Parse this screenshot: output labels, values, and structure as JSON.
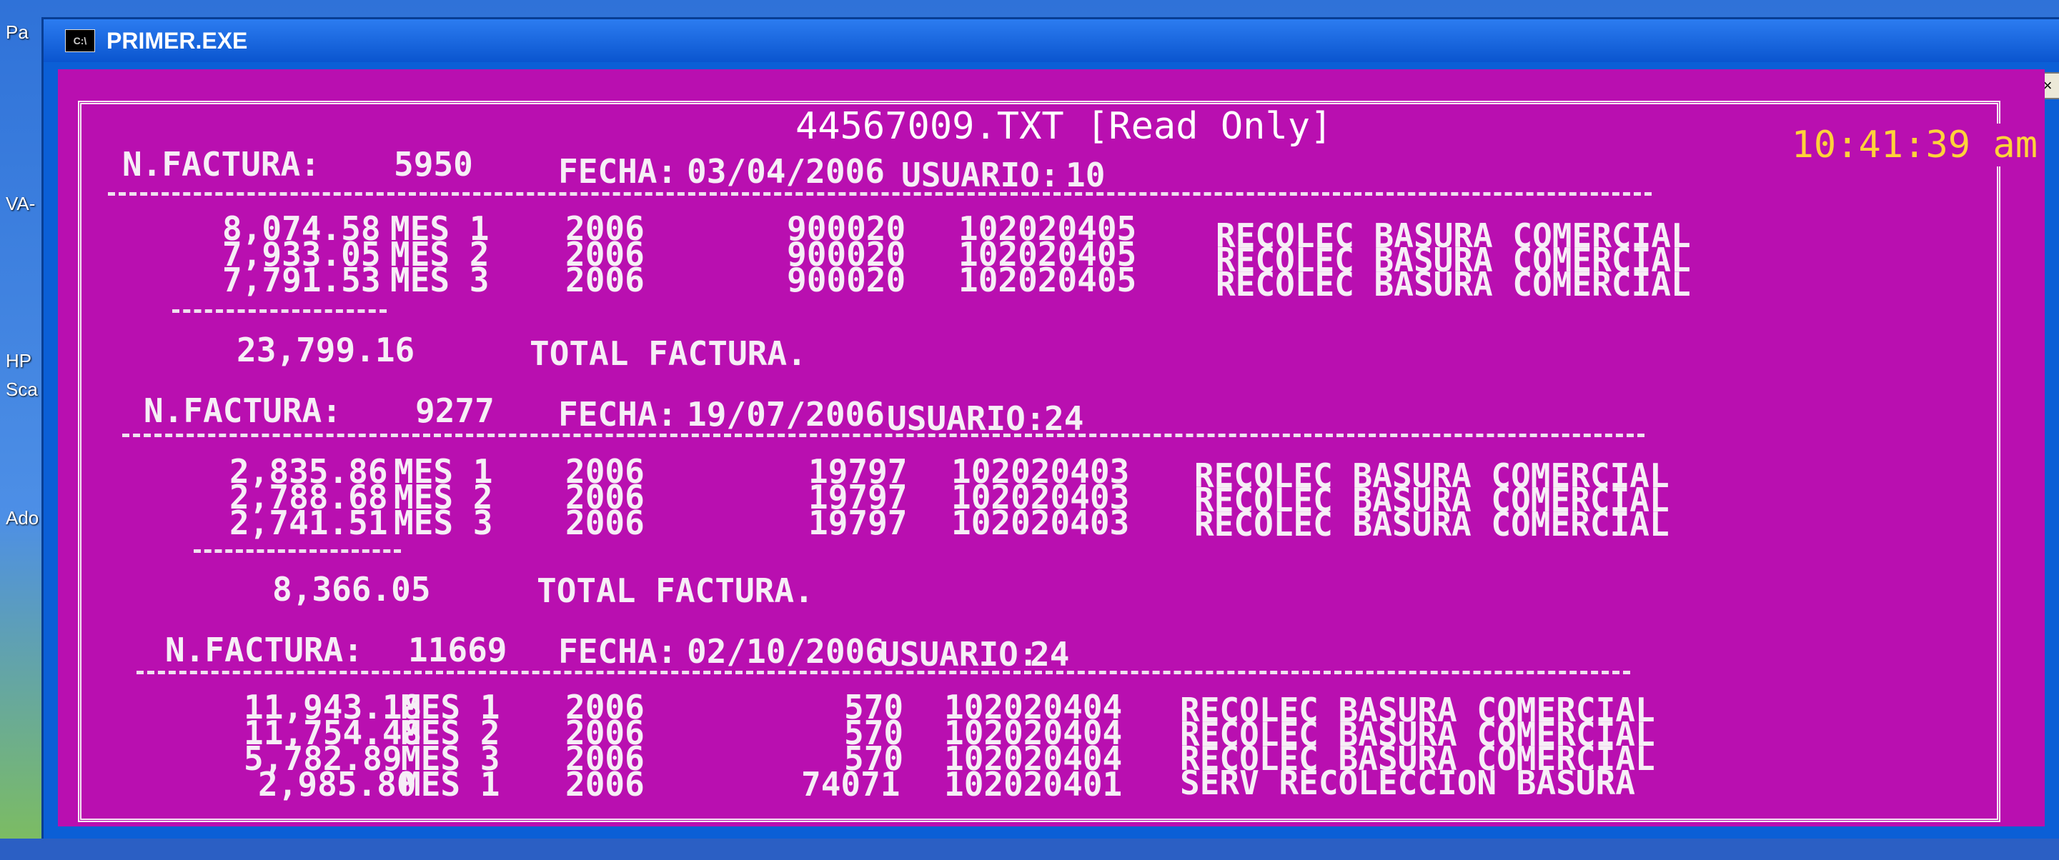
{
  "desktop": {
    "icon_labels": [
      "Pa",
      "VA-",
      "HP",
      "Sca",
      "Ado"
    ]
  },
  "window": {
    "title": "PRIMER.EXE",
    "icon_text": "C:\\",
    "controls": [
      "_",
      "□",
      "×"
    ]
  },
  "console": {
    "file_title": "44567009.TXT [Read Only]",
    "clock": "10:41:39 am",
    "invoices": [
      {
        "label": "N.FACTURA:",
        "number": "5950",
        "fecha_label": "FECHA:",
        "fecha": "03/04/2006",
        "usuario_label": "USUARIO:",
        "usuario": "10",
        "lines": [
          {
            "amount": "8,074.58",
            "mes": "MES 1",
            "year": "2006",
            "code": "900020",
            "account": "102020405",
            "desc": "RECOLEC BASURA COMERCIAL"
          },
          {
            "amount": "7,933.05",
            "mes": "MES 2",
            "year": "2006",
            "code": "900020",
            "account": "102020405",
            "desc": "RECOLEC BASURA COMERCIAL"
          },
          {
            "amount": "7,791.53",
            "mes": "MES 3",
            "year": "2006",
            "code": "900020",
            "account": "102020405",
            "desc": "RECOLEC BASURA COMERCIAL"
          }
        ],
        "total": "23,799.16",
        "total_label": "TOTAL FACTURA."
      },
      {
        "label": "N.FACTURA:",
        "number": "9277",
        "fecha_label": "FECHA:",
        "fecha": "19/07/2006",
        "usuario_label": "USUARIO:",
        "usuario": "24",
        "lines": [
          {
            "amount": "2,835.86",
            "mes": "MES 1",
            "year": "2006",
            "code": "19797",
            "account": "102020403",
            "desc": "RECOLEC BASURA COMERCIAL"
          },
          {
            "amount": "2,788.68",
            "mes": "MES 2",
            "year": "2006",
            "code": "19797",
            "account": "102020403",
            "desc": "RECOLEC BASURA COMERCIAL"
          },
          {
            "amount": "2,741.51",
            "mes": "MES 3",
            "year": "2006",
            "code": "19797",
            "account": "102020403",
            "desc": "RECOLEC BASURA COMERCIAL"
          }
        ],
        "total": "8,366.05",
        "total_label": "TOTAL FACTURA."
      },
      {
        "label": "N.FACTURA:",
        "number": "11669",
        "fecha_label": "FECHA:",
        "fecha": "02/10/2006",
        "usuario_label": "USUARIO:",
        "usuario": "24",
        "lines": [
          {
            "amount": "11,943.18",
            "mes": "MES 1",
            "year": "2006",
            "code": "570",
            "account": "102020404",
            "desc": "RECOLEC BASURA COMERCIAL"
          },
          {
            "amount": "11,754.48",
            "mes": "MES 2",
            "year": "2006",
            "code": "570",
            "account": "102020404",
            "desc": "RECOLEC BASURA COMERCIAL"
          },
          {
            "amount": "5,782.89",
            "mes": "MES 3",
            "year": "2006",
            "code": "570",
            "account": "102020404",
            "desc": "RECOLEC BASURA COMERCIAL"
          },
          {
            "amount": "2,985.80",
            "mes": "MES 1",
            "year": "2006",
            "code": "74071",
            "account": "102020401",
            "desc": "SERV RECOLECCION BASURA"
          }
        ]
      }
    ]
  }
}
